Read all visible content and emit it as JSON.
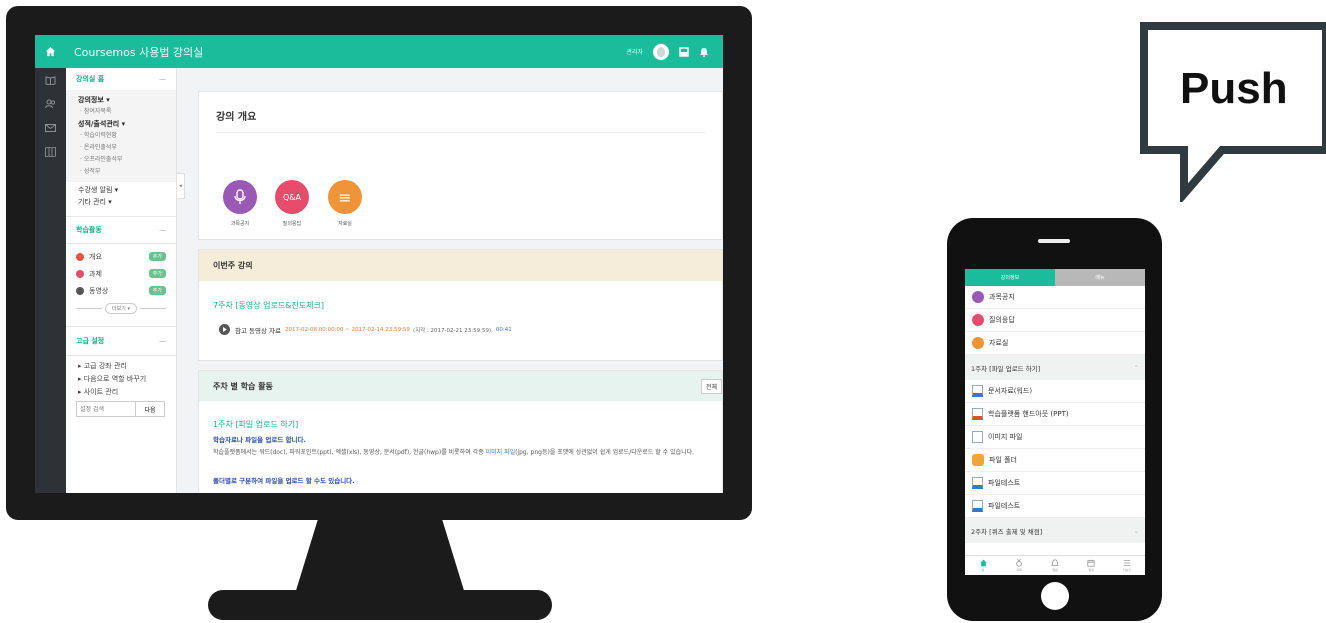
{
  "colors": {
    "accent": "#1abc9c",
    "notice": "#9b59b6",
    "qna": "#e74c6c",
    "resource": "#f0943a",
    "week_bg": "#f5ecd9",
    "weekly_bg": "#e7f3ef"
  },
  "lms": {
    "title": "Coursemos 사용법 강의실",
    "admin_label": "관리자",
    "nav": {
      "home": "강의실 홈",
      "items": [
        "강의정보 ▾",
        "· 참여자목록",
        "성적/출석관리 ▾",
        "· 학습이력현황",
        "· 온라인출석부",
        "· 오프라인출석부",
        "· 성적부",
        "수강생 알림 ▾",
        "기타 관리 ▾"
      ],
      "activities_title": "학습활동",
      "activities": [
        {
          "label": "개요",
          "badge": "추가",
          "icon": "notice-dot"
        },
        {
          "label": "과제",
          "badge": "추가",
          "icon": "assignment-dot"
        },
        {
          "label": "동영상",
          "badge": "추가",
          "icon": "video-dot"
        }
      ],
      "more": "더보기 ▾",
      "advanced_title": "고급 설정",
      "advanced": [
        "▸ 고급 강좌 관리",
        "▸ 다음으로 역할 바꾸기",
        "▸ 사이트 관리"
      ],
      "search_placeholder": "설정 검색",
      "search_button": "다음"
    },
    "overview": {
      "title": "강의 개요",
      "icons": [
        {
          "label": "과목공지",
          "glyph": "🎙",
          "icon": "microphone-icon"
        },
        {
          "label": "질의응답",
          "glyph": "Q&A",
          "icon": "qna-icon"
        },
        {
          "label": "자료실",
          "glyph": "≡",
          "icon": "list-icon"
        }
      ]
    },
    "this_week": {
      "title": "이번주 강의",
      "link": "7주차 [동영상 업로드&진도체크]",
      "item_label": "참고 동영상 자료",
      "item_period": "2017-02-08 00:00:00 ~ 2017-02-14 23:59:59",
      "item_late": "(지각 : 2017-02-21 23:59:59),",
      "item_duration": "00:41"
    },
    "weekly": {
      "title": "주차 별 학습 활동",
      "view_all": "전체",
      "week1_link": "1주차 [파일 업로드 하기]",
      "week1_bold": "학습자료나 파일을 업로드 합니다.",
      "week1_desc_a": "학습플랫폼에서는 워드(doc), 파워포인트(ppt), 엑셀(xls), 동영상, 문서(pdf), 한글(hwp)를 비롯하여 각종 ",
      "week1_desc_link": "이미지 파일",
      "week1_desc_b": "(jpg, png등)을 포맷에 상관없이 쉽게 업로드/다운로드 할 수 있습니다.",
      "week1_bold2": "폴더별로 구분하여 파일을 업로드 할 수도 있습니다."
    }
  },
  "push_label": "Push",
  "mobile": {
    "tabs": [
      "강의정보",
      "메뉴"
    ],
    "top_items": [
      {
        "label": "과목공지",
        "icon": "microphone-icon"
      },
      {
        "label": "질의응답",
        "icon": "qna-icon"
      },
      {
        "label": "자료실",
        "icon": "list-icon"
      }
    ],
    "week1": "1주차 [파일 업로드 하기]",
    "files": [
      "문서자료(워드)",
      "학습플랫폼 핸드아웃 (PPT)",
      "이미지 파일",
      "파일 폴더",
      "파일테스트",
      "파일테스트"
    ],
    "week2": "2주차 [퀴즈 출제 및 채점]",
    "bottom": [
      "홈",
      "과목",
      "알림",
      "일정",
      "더보기"
    ]
  }
}
